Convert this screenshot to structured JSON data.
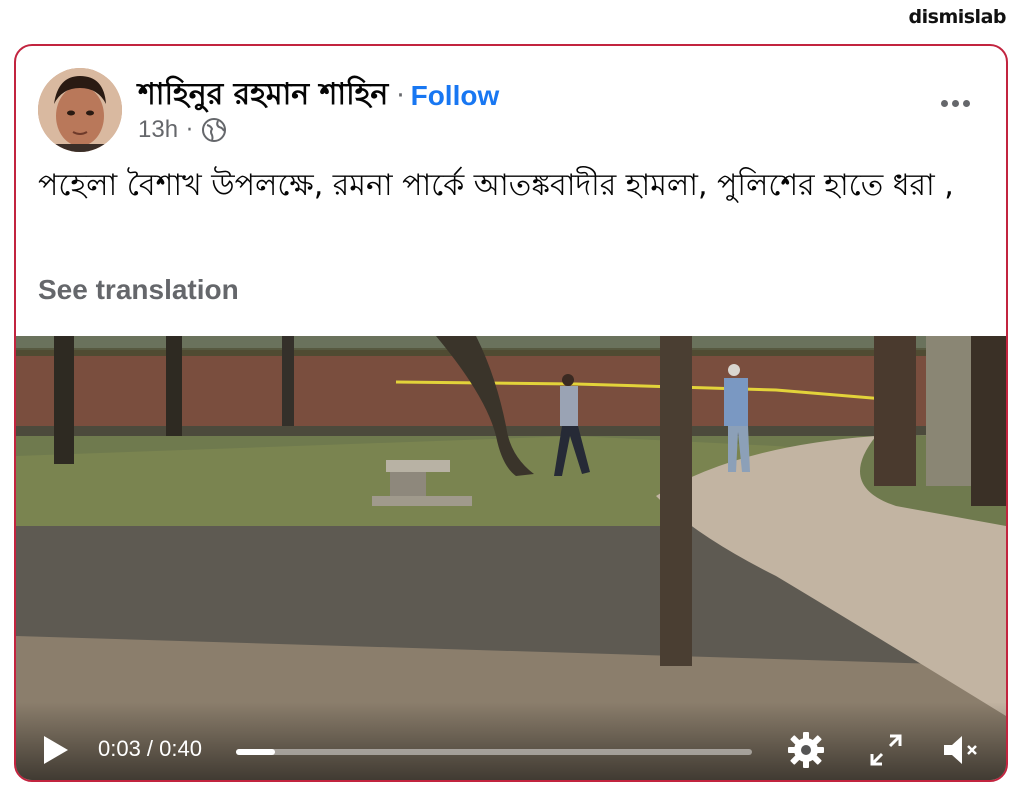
{
  "watermark": "dismislab",
  "post": {
    "author": "শাহিনুর রহমান শাহিন",
    "separator": "·",
    "follow_label": "Follow",
    "time": "13h",
    "meta_separator": "·",
    "audience_icon": "globe-icon",
    "more_icon": "more-options-icon",
    "text": "পহেলা বৈশাখ উপলক্ষে, রমনা পার্কে আতঙ্কবাদীর হামলা, পুলিশের হাতে ধরা ,",
    "see_translation_label": "See translation"
  },
  "video": {
    "current_time": "0:03 / 0:40",
    "progress_fraction": 0.075,
    "icons": {
      "play": "play-icon",
      "settings": "gear-icon",
      "fullscreen": "fullscreen-icon",
      "volume": "volume-muted-icon"
    }
  },
  "colors": {
    "follow": "#1877f2",
    "card_border": "#c2243f",
    "secondary_text": "#65676b"
  }
}
